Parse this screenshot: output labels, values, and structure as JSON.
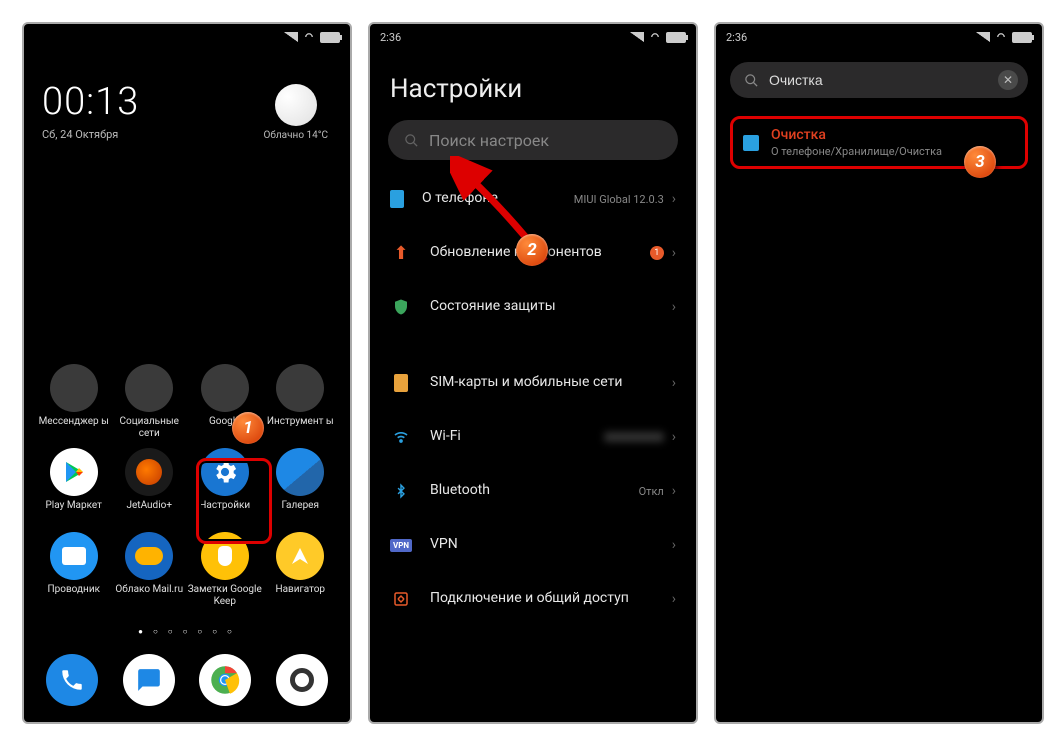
{
  "phone1": {
    "statusbar": {
      "time": ""
    },
    "clock": {
      "time": "00:13",
      "date": "Сб, 24 Октября"
    },
    "weather": {
      "text": "Облачно  14°C"
    },
    "apps": [
      {
        "label": "Мессенджер\nы"
      },
      {
        "label": "Социальные\nсети"
      },
      {
        "label": "Google"
      },
      {
        "label": "Инструмент\nы"
      },
      {
        "label": "Play Маркет"
      },
      {
        "label": "JetAudio+"
      },
      {
        "label": "Настройки"
      },
      {
        "label": "Галерея"
      },
      {
        "label": "Проводник"
      },
      {
        "label": "Облако\nMail.ru"
      },
      {
        "label": "Заметки\nGoogle Keep"
      },
      {
        "label": "Навигатор"
      }
    ],
    "dock": [
      "Телефон",
      "Сообщения",
      "Chrome",
      "Камера"
    ]
  },
  "phone2": {
    "statusbar": {
      "time": "2:36"
    },
    "title": "Настройки",
    "search_placeholder": "Поиск настроек",
    "items": [
      {
        "label": "О телефоне",
        "meta": "MIUI Global 12.0.3"
      },
      {
        "label": "Обновление компонентов",
        "badge": "1"
      },
      {
        "label": "Состояние защиты"
      },
      {
        "label": "SIM-карты и мобильные сети"
      },
      {
        "label": "Wi-Fi",
        "meta": ""
      },
      {
        "label": "Bluetooth",
        "meta": "Откл"
      },
      {
        "label": "VPN"
      },
      {
        "label": "Подключение и общий доступ"
      }
    ]
  },
  "phone3": {
    "statusbar": {
      "time": "2:36"
    },
    "search_value": "Очистка",
    "result": {
      "title": "Очистка",
      "path": "О телефоне/Хранилище/Очистка"
    }
  },
  "annotations": {
    "step1": "1",
    "step2": "2",
    "step3": "3"
  }
}
